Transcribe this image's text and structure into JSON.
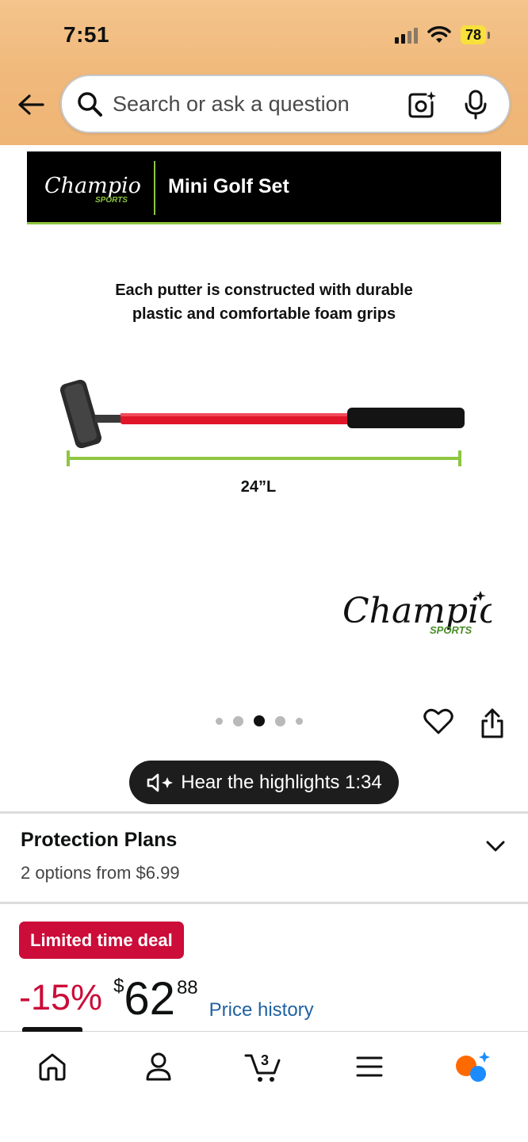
{
  "status_bar": {
    "time": "7:51",
    "battery": "78"
  },
  "search": {
    "placeholder": "Search or ask a question"
  },
  "product_image": {
    "brand_logo_text": "Champion",
    "brand_logo_subtext": "SPORTS",
    "banner_title": "Mini Golf Set",
    "caption_line1": "Each putter is constructed with durable",
    "caption_line2": "plastic and comfortable foam grips",
    "measurement_label": "24”L"
  },
  "carousel": {
    "total": 5,
    "active_index": 2
  },
  "audio_summary": {
    "label": "Hear the highlights 1:34"
  },
  "protection_plans": {
    "title": "Protection Plans",
    "subtitle": "2 options from $6.99"
  },
  "deal": {
    "badge": "Limited time deal",
    "discount": "-15%",
    "currency": "$",
    "price_whole": "62",
    "price_fraction": "88",
    "price_history": "Price history"
  },
  "bottom_nav": {
    "cart_count": "3"
  },
  "colors": {
    "deal_red": "#cc0c39",
    "link_blue": "#2162a1",
    "accent_green": "#8dc63f",
    "header_orange": "#f0b87a"
  }
}
